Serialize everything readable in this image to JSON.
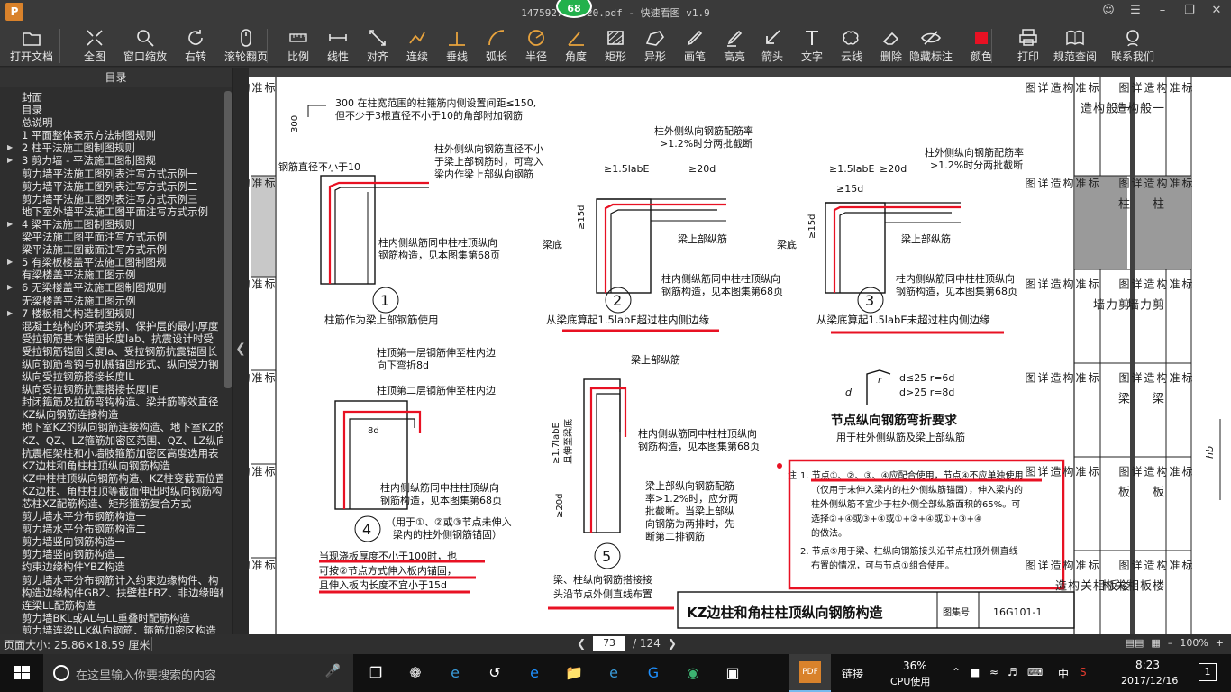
{
  "window": {
    "title": "1475927706320.pdf - 快速看图 v1.9",
    "badge": "68",
    "logo": "P"
  },
  "toolbar": {
    "items": [
      {
        "label": "打开文档",
        "icon": "folder-icon"
      },
      {
        "label": "全图",
        "icon": "fit-icon"
      },
      {
        "label": "窗口缩放",
        "icon": "zoom-icon"
      },
      {
        "label": "右转",
        "icon": "rotate-icon"
      },
      {
        "label": "滚轮翻页",
        "icon": "mouse-icon"
      },
      {
        "label": "比例",
        "icon": "scale-icon"
      },
      {
        "label": "线性",
        "icon": "linear-icon"
      },
      {
        "label": "对齐",
        "icon": "align-icon"
      },
      {
        "label": "连续",
        "icon": "continuous-icon"
      },
      {
        "label": "垂线",
        "icon": "perpendicular-icon"
      },
      {
        "label": "弧长",
        "icon": "arc-icon"
      },
      {
        "label": "半径",
        "icon": "radius-icon"
      },
      {
        "label": "角度",
        "icon": "angle-icon"
      },
      {
        "label": "矩形",
        "icon": "rectangle-icon"
      },
      {
        "label": "异形",
        "icon": "polygon-icon"
      },
      {
        "label": "画笔",
        "icon": "pen-icon"
      },
      {
        "label": "高亮",
        "icon": "highlight-icon"
      },
      {
        "label": "箭头",
        "icon": "arrow-icon"
      },
      {
        "label": "文字",
        "icon": "text-icon"
      },
      {
        "label": "云线",
        "icon": "cloud-icon"
      },
      {
        "label": "删除",
        "icon": "eraser-icon"
      },
      {
        "label": "隐藏标注",
        "icon": "hide-icon"
      },
      {
        "label": "颜色",
        "icon": "color-icon"
      },
      {
        "label": "打印",
        "icon": "print-icon"
      },
      {
        "label": "规范查阅",
        "icon": "book-icon"
      },
      {
        "label": "联系我们",
        "icon": "contact-icon"
      }
    ],
    "color_swatch": "#e81123"
  },
  "sidebar": {
    "title": "目录",
    "items": [
      {
        "label": "封面",
        "arrow": false
      },
      {
        "label": "目录",
        "arrow": false
      },
      {
        "label": "总说明",
        "arrow": false
      },
      {
        "label": "1 平面整体表示方法制图规则",
        "arrow": false
      },
      {
        "label": "2 柱平法施工图制图规则",
        "arrow": true
      },
      {
        "label": "3 剪力墙 - 平法施工图制图规",
        "arrow": true
      },
      {
        "label": "剪力墙平法施工图列表注写方式示例一",
        "arrow": false
      },
      {
        "label": "剪力墙平法施工图列表注写方式示例二",
        "arrow": false
      },
      {
        "label": "剪力墙平法施工图列表注写方式示例三",
        "arrow": false
      },
      {
        "label": "地下室外墙平法施工图平面注写方式示例",
        "arrow": false
      },
      {
        "label": "4 梁平法施工图制图规则",
        "arrow": true
      },
      {
        "label": "梁平法施工图平面注写方式示例",
        "arrow": false
      },
      {
        "label": "梁平法施工图截面注写方式示例",
        "arrow": false
      },
      {
        "label": "5 有梁板楼盖平法施工图制图规",
        "arrow": true
      },
      {
        "label": "有梁楼盖平法施工图示例",
        "arrow": false
      },
      {
        "label": "6 无梁楼盖平法施工图制图规则",
        "arrow": true
      },
      {
        "label": "无梁楼盖平法施工图示例",
        "arrow": false
      },
      {
        "label": "7 楼板相关构造制图规则",
        "arrow": true
      },
      {
        "label": "混凝土结构的环境类别、保护层的最小厚度",
        "arrow": false
      },
      {
        "label": "受拉钢筋基本锚固长度lab、抗震设计时受",
        "arrow": false
      },
      {
        "label": "受拉钢筋锚固长度la、受拉钢筋抗震锚固长",
        "arrow": false
      },
      {
        "label": "纵向钢筋弯钩与机械锚固形式、纵向受力钢",
        "arrow": false
      },
      {
        "label": "纵向受拉钢筋搭接长度lL",
        "arrow": false
      },
      {
        "label": "纵向受拉钢筋抗震搭接长度llE",
        "arrow": false
      },
      {
        "label": "封闭箍筋及拉筋弯钩构造、梁并筋等效直径",
        "arrow": false
      },
      {
        "label": "KZ纵向钢筋连接构造",
        "arrow": false
      },
      {
        "label": "地下室KZ的纵向钢筋连接构造、地下室KZ的",
        "arrow": false
      },
      {
        "label": "KZ、QZ、LZ箍筋加密区范围、QZ、LZ纵向钢",
        "arrow": false
      },
      {
        "label": "抗震框架柱和小墙肢箍筋加密区高度选用表",
        "arrow": false
      },
      {
        "label": "KZ边柱和角柱柱顶纵向钢筋构造",
        "arrow": false
      },
      {
        "label": "KZ中柱柱顶纵向钢筋构造、KZ柱变截面位置",
        "arrow": false
      },
      {
        "label": "KZ边柱、角柱柱顶等截面伸出时纵向钢筋构",
        "arrow": false
      },
      {
        "label": "芯柱XZ配筋构造、矩形箍筋复合方式",
        "arrow": false
      },
      {
        "label": "剪力墙水平分布钢筋构造一",
        "arrow": false
      },
      {
        "label": "剪力墙水平分布钢筋构造二",
        "arrow": false
      },
      {
        "label": "剪力墙竖向钢筋构造一",
        "arrow": false
      },
      {
        "label": "剪力墙竖向钢筋构造二",
        "arrow": false
      },
      {
        "label": "约束边缘构件YBZ构造",
        "arrow": false
      },
      {
        "label": "剪力墙水平分布钢筋计入约束边缘构件、构",
        "arrow": false
      },
      {
        "label": "构造边缘构件GBZ、扶壁柱FBZ、非边缘暗柱",
        "arrow": false
      },
      {
        "label": "连梁LL配筋构造",
        "arrow": false
      },
      {
        "label": "剪力墙BKL或AL与LL重叠时配筋构造",
        "arrow": false
      },
      {
        "label": "剪力墙连梁LLK纵向钢筋、箍筋加密区构造",
        "arrow": false
      }
    ]
  },
  "document": {
    "left_tabs": [
      "标准构造详图",
      "标准构造详图",
      "标准构造详图",
      "标准构造详图",
      "标准构造详图",
      "标准构造详图"
    ],
    "right_tabs": [
      {
        "a": "标准构造详图",
        "b": "一般构造"
      },
      {
        "a": "标准构造详图",
        "b": "柱"
      },
      {
        "a": "标准构造详图",
        "b": "剪力墙"
      },
      {
        "a": "标准构造详图",
        "b": "梁"
      },
      {
        "a": "标准构造详图",
        "b": "板"
      },
      {
        "a": "标准构造详图",
        "b": "楼板相关构造"
      }
    ],
    "next_page_tabs": [
      "一般构造",
      "柱",
      "剪力墙",
      "梁",
      "板",
      "楼板相关构"
    ],
    "next_page_col": [
      "标准构造详图",
      "标准构造详图",
      "标准构造详图",
      "标准构造详图",
      "标准构造详图",
      "标准构造详图"
    ],
    "node1": {
      "num": "1",
      "caption": "柱筋作为梁上部钢筋使用",
      "note_top1": "300  在柱宽范围的柱箍筋内侧设置间距≤150,",
      "note_top2": "但不少于3根直径不小于10的角部附加钢筋",
      "dim300": "300",
      "rebar_dia": "钢筋直径不小于10",
      "t1": "柱外侧纵向钢筋直径不小",
      "t2": "于梁上部钢筋时，可弯入",
      "t3": "梁内作梁上部纵向钢筋",
      "t4": "柱内侧纵筋同中柱柱顶纵向",
      "t5": "钢筋构造，见本图集第68页"
    },
    "node2": {
      "num": "2",
      "caption": "从梁底算起1.5labE超过柱内侧边缘",
      "t1": "柱外侧纵向钢筋配筋率",
      "t2": ">1.2%时分两批截断",
      "d1": "≥1.5labE",
      "d2": "≥20d",
      "d3": "≥15d",
      "beam_bottom": "梁底",
      "top_bar": "梁上部纵筋",
      "t4": "柱内侧纵筋同中柱柱顶纵向",
      "t5": "钢筋构造，见本图集第68页"
    },
    "node3": {
      "num": "3",
      "caption": "从梁底算起1.5labE未超过柱内侧边缘",
      "t1": "柱外侧纵向钢筋配筋率",
      "t2": ">1.2%时分两批截断",
      "d1": "≥1.5labE",
      "d2": "≥20d",
      "d3": "≥15d",
      "d4": "≥15d",
      "beam_bottom": "梁底",
      "top_bar": "梁上部纵筋",
      "t4": "柱内侧纵筋同中柱柱顶纵向",
      "t5": "钢筋构造，见本图集第68页"
    },
    "node4": {
      "num": "4",
      "t1": "柱顶第一层钢筋伸至柱内边",
      "t2": "向下弯折8d",
      "t3": "柱顶第二层钢筋伸至柱内边",
      "d1": "8d",
      "t4": "柱内侧纵筋同中柱柱顶纵向",
      "t5": "钢筋构造，见本图集第68页",
      "note1": "（用于①、②或③节点未伸入",
      "note2": "梁内的柱外侧钢筋锚固）",
      "c1": "当现浇板厚度不小于100时，也",
      "c2": "可按②节点方式伸入板内锚固，",
      "c3": "且伸入板内长度不宜小于15d"
    },
    "node5": {
      "num": "5",
      "top": "梁上部纵筋",
      "d1": "≥1.7labE",
      "d1b": "且伸至梁底",
      "d2": "≥20d",
      "t1": "柱内侧纵筋同中柱柱顶纵向",
      "t2": "钢筋构造，见本图集第68页",
      "t3": "梁上部纵向钢筋配筋",
      "t4": "率>1.2%时，应分两",
      "t5": "批截断。当梁上部纵",
      "t6": "向钢筋为两排时，先",
      "t7": "断第二排钢筋",
      "c1": "梁、柱纵向钢筋搭接接",
      "c2": "头沿节点外侧直线布置"
    },
    "bend": {
      "title": "节点纵向钢筋弯折要求",
      "sub": "用于柱外侧纵筋及梁上部纵筋",
      "r1": "d≤25   r=6d",
      "r2": "d>25   r=8d",
      "label_d": "d",
      "label_r": "r"
    },
    "notes": {
      "head": "注",
      "l1": "1. 节点①、②、③、④应配合使用，节点④不应单独使用",
      "l2": "（仅用于未伸入梁内的柱外侧纵筋锚固），伸入梁内的",
      "l3": "柱外侧纵筋不宜少于柱外侧全部纵筋面积的65%。可",
      "l4": "选择②+④或③+④或①+②+④或①+③+④",
      "l5": "的做法。",
      "l6": "2. 节点⑤用于梁、柱纵向钢筋接头沿节点柱顶外侧直线",
      "l7": "布置的情况，可与节点①组合使用。"
    },
    "titleblock": {
      "title": "KZ边柱和角柱柱顶纵向钢筋构造",
      "label": "图集号",
      "code": "16G101-1"
    },
    "next_hb": "hb",
    "annotation_color": "#e81123"
  },
  "status": {
    "page_size": "页面大小: 25.86×18.59 厘米",
    "current_page": "73",
    "total_pages": "/ 124",
    "zoom": "100%"
  },
  "taskbar": {
    "search_placeholder": "在这里输入你要搜索的内容",
    "link_label": "链接",
    "cpu_percent": "36%",
    "cpu_label": "CPU使用",
    "ime": "中",
    "time": "8:23",
    "date": "2017/12/16",
    "notif_count": "1"
  }
}
